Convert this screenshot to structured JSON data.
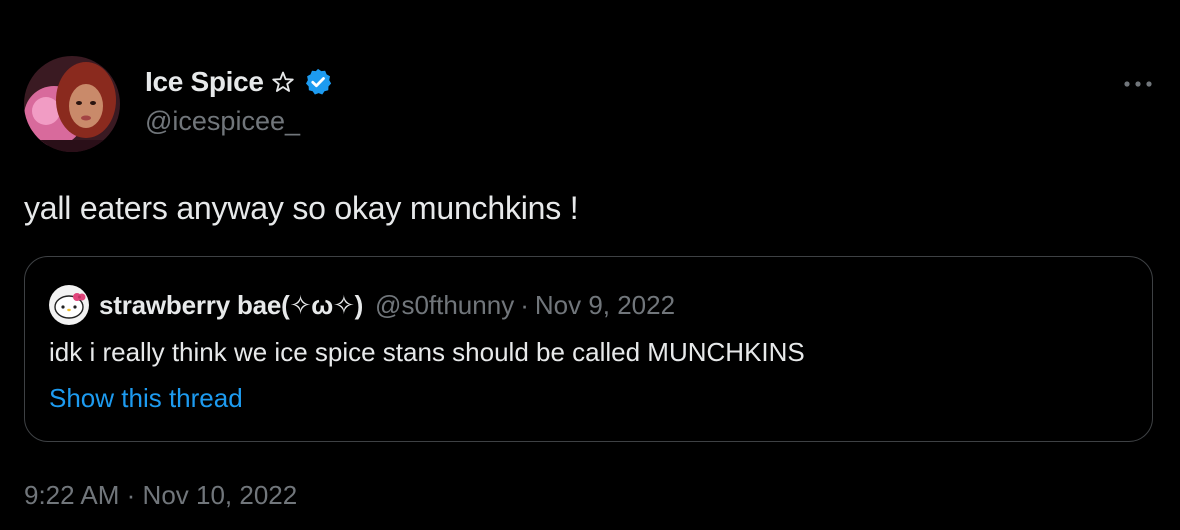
{
  "tweet": {
    "author": {
      "display_name": "Ice Spice",
      "handle": "@icespicee_",
      "name_emoji_icon": "star-outline-icon",
      "verified_icon": "verified-badge-icon",
      "verified_color": "#1d9bf0"
    },
    "more_icon": "more-horizontal-icon",
    "text": "yall eaters anyway so okay munchkins !",
    "quoted": {
      "display_name": "strawberry bae(✧ω✧)",
      "handle": "@s0fthunny",
      "separator": "·",
      "date": "Nov 9, 2022",
      "text": "idk i really think we ice spice stans should be called MUNCHKINS",
      "show_thread": "Show this thread",
      "link_color": "#1d9bf0"
    },
    "timestamp": {
      "time": "9:22 AM",
      "separator": "·",
      "date": "Nov 10, 2022"
    }
  }
}
